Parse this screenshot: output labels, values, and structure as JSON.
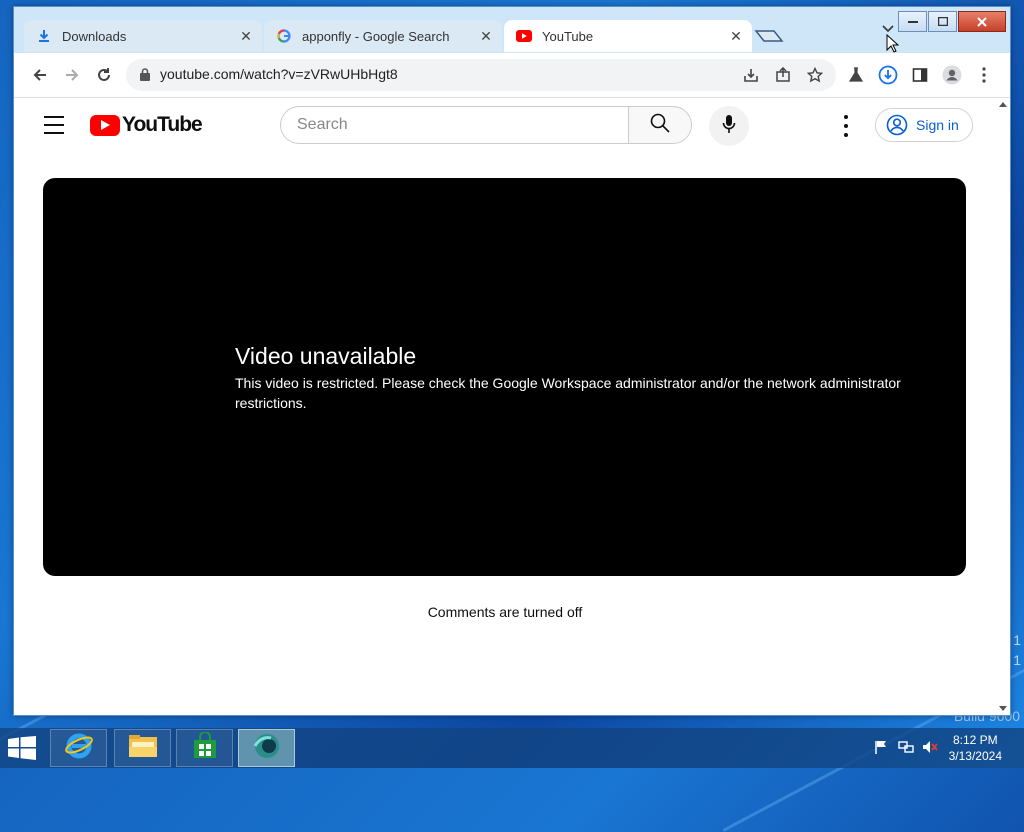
{
  "desktop": {
    "build_text": "Build 9600",
    "side_text_1": "1",
    "side_text_2": "1"
  },
  "browser": {
    "tabs": [
      {
        "label": "Downloads",
        "icon": "download-icon",
        "active": false
      },
      {
        "label": "apponfly - Google Search",
        "icon": "google-icon",
        "active": false
      },
      {
        "label": "YouTube",
        "icon": "youtube-icon",
        "active": true
      }
    ],
    "close_glyph": "✕",
    "url": "youtube.com/watch?v=zVRwUHbHgt8"
  },
  "youtube": {
    "logo_text": "YouTube",
    "search_placeholder": "Search",
    "signin_label": "Sign in",
    "error_title": "Video unavailable",
    "error_message": "This video is restricted. Please check the Google Workspace administrator and/or the network administrator restrictions.",
    "comments_text": "Comments are turned off"
  },
  "taskbar": {
    "time": "8:12 PM",
    "date": "3/13/2024",
    "apps": [
      "internet-explorer-icon",
      "file-explorer-icon",
      "store-icon",
      "app-icon"
    ]
  },
  "colors": {
    "youtube_red": "#ff0000",
    "link_blue": "#065fd4",
    "player_bg": "#000000"
  }
}
